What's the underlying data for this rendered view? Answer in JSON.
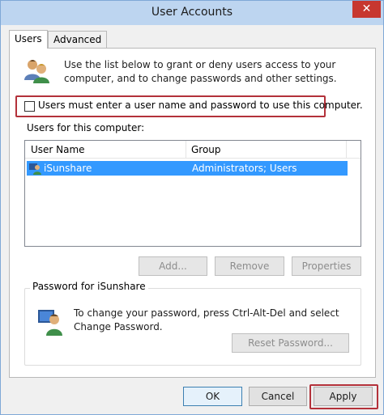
{
  "window": {
    "title": "User Accounts",
    "close_glyph": "✕"
  },
  "tabs": [
    {
      "label": "Users",
      "active": true
    },
    {
      "label": "Advanced",
      "active": false
    }
  ],
  "users_tab": {
    "description": "Use the list below to grant or deny users access to your computer, and to change passwords and other settings.",
    "require_login_label": "Users must enter a user name and password to use this computer.",
    "require_login_checked": false,
    "users_list_label": "Users for this computer:",
    "columns": [
      "User Name",
      "Group"
    ],
    "rows": [
      {
        "user": "iSunshare",
        "group": "Administrators; Users",
        "selected": true
      }
    ],
    "buttons": {
      "add": "Add...",
      "remove": "Remove",
      "properties": "Properties"
    },
    "password_group": {
      "title": "Password for iSunshare",
      "description": "To change your password, press Ctrl-Alt-Del and select Change Password.",
      "reset_button": "Reset Password..."
    }
  },
  "footer": {
    "ok": "OK",
    "cancel": "Cancel",
    "apply": "Apply"
  },
  "colors": {
    "titlebar": "#bdd5f0",
    "close": "#c7372f",
    "selection": "#3399ff",
    "highlight_annotation": "#b3313a"
  },
  "icons": {
    "users_icon": "users-group-icon",
    "row_icon": "user-icon",
    "password_icon": "user-key-icon"
  }
}
